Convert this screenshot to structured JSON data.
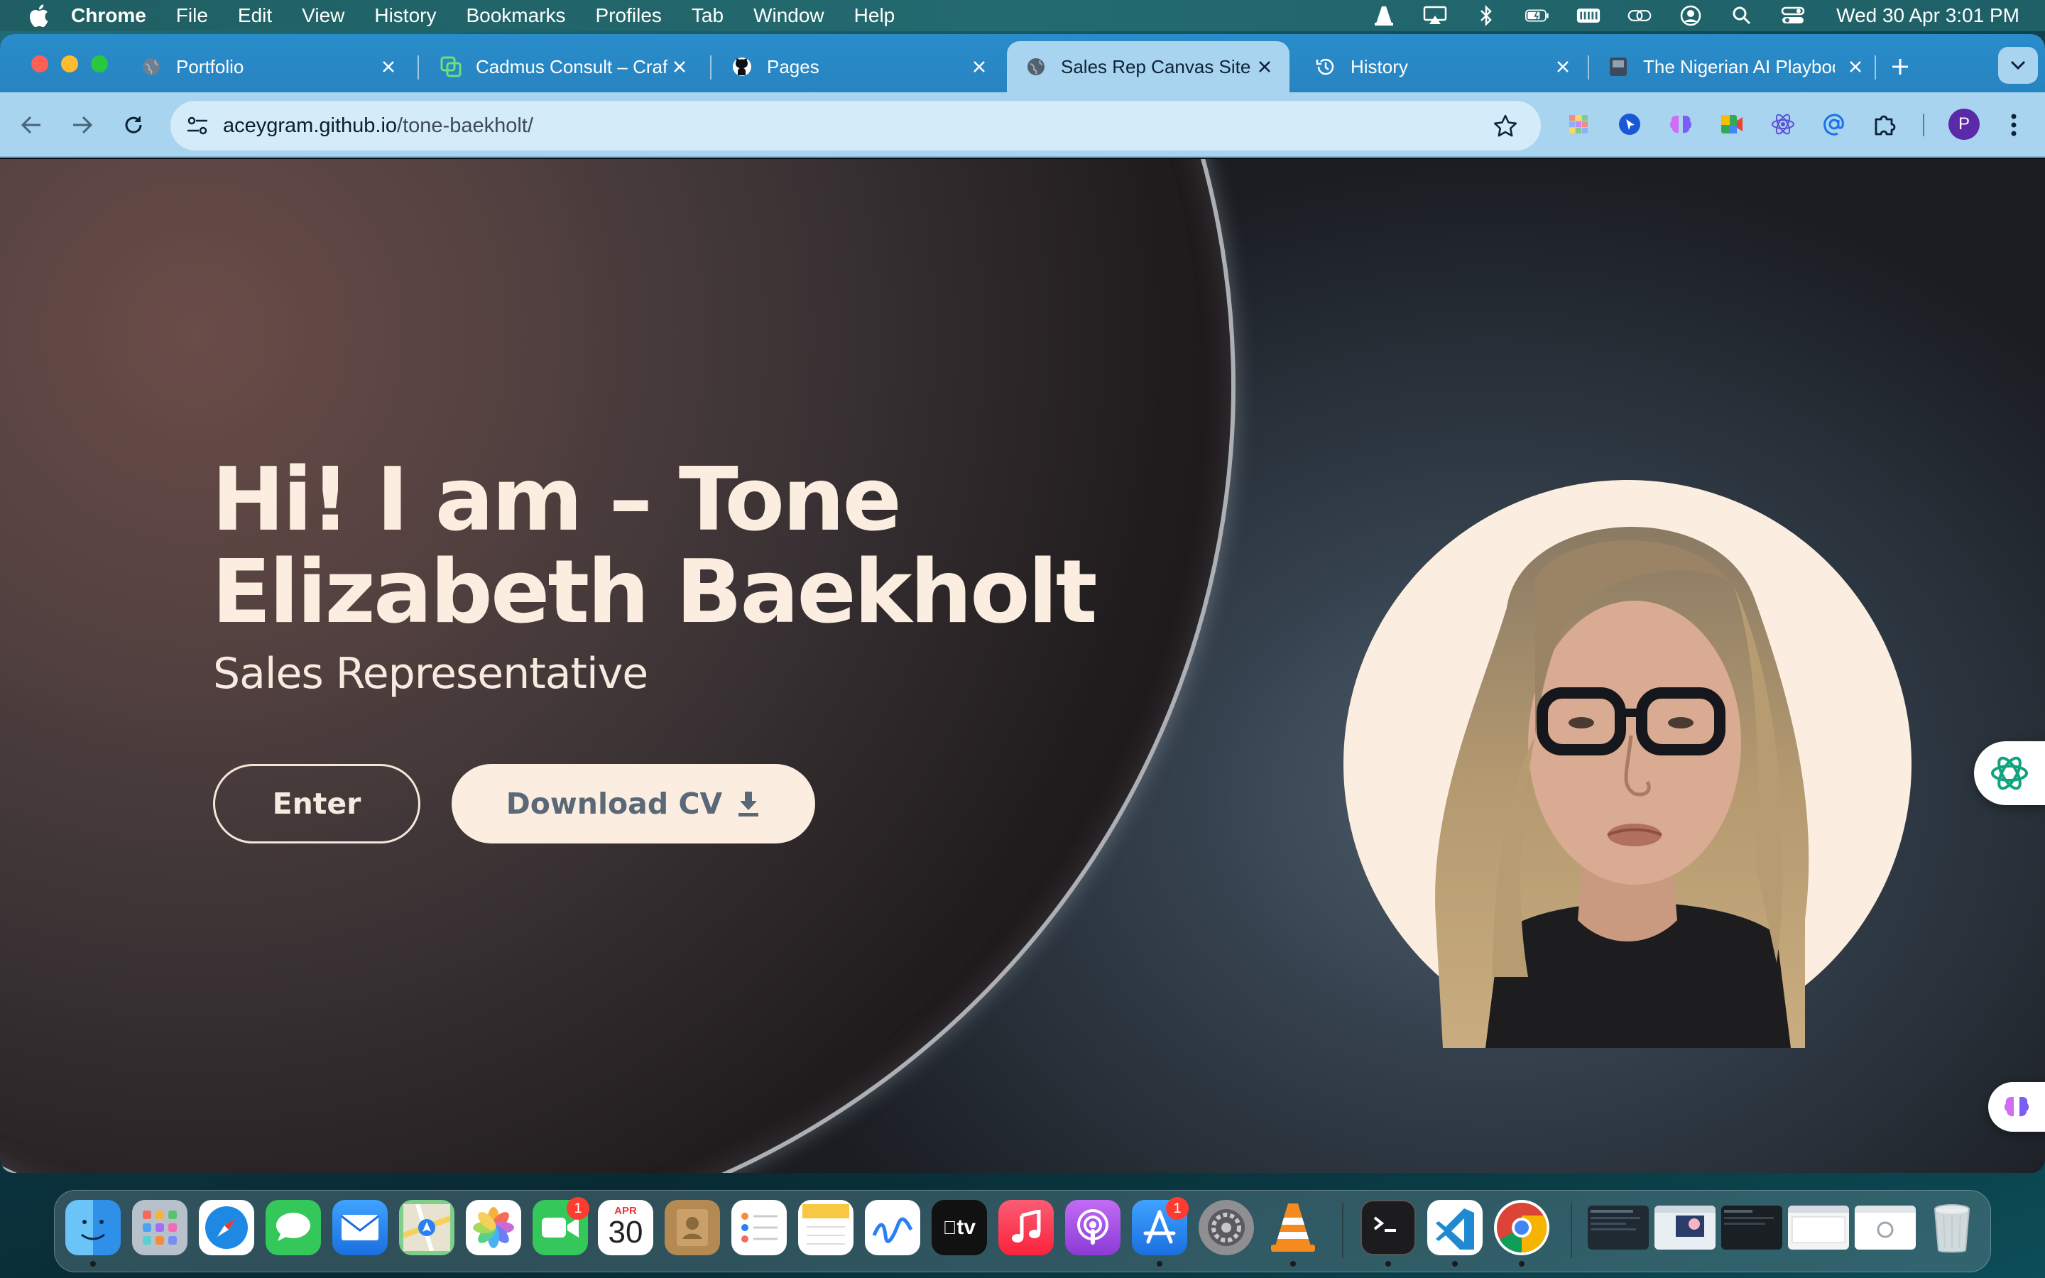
{
  "menubar": {
    "app_name": "Chrome",
    "items": [
      "File",
      "Edit",
      "View",
      "History",
      "Bookmarks",
      "Profiles",
      "Tab",
      "Window",
      "Help"
    ],
    "status_icons": [
      "vlc-icon",
      "airplay-icon",
      "bluetooth-icon",
      "battery-icon",
      "keyboard-icon",
      "link-icon",
      "user-icon",
      "search-icon",
      "control-center-icon"
    ],
    "clock": "Wed 30 Apr  3:01 PM"
  },
  "browser": {
    "tabs": [
      {
        "title": "Portfolio",
        "icon": "globe-icon"
      },
      {
        "title": "Cadmus Consult – Craft",
        "icon": "cadmus-icon"
      },
      {
        "title": "Pages",
        "icon": "github-icon"
      },
      {
        "title": "Sales Rep Canvas Site",
        "icon": "globe-icon",
        "active": true
      },
      {
        "title": "History",
        "icon": "history-icon"
      },
      {
        "title": "The Nigerian AI Playbook",
        "icon": "book-icon"
      }
    ],
    "url_host": "aceygram.github.io",
    "url_path": "/tone-baekholt/",
    "profile_initial": "P",
    "extensions": [
      "grid-extension-icon",
      "cursor-extension-icon",
      "brain-extension-icon",
      "meet-extension-icon",
      "react-extension-icon",
      "at-extension-icon",
      "puzzle-icon"
    ]
  },
  "hero": {
    "title_line1": "Hi! I am – Tone",
    "title_line2": "Elizabeth Baekholt",
    "subtitle": "Sales Representative",
    "enter_label": "Enter",
    "download_label": "Download CV"
  },
  "dock": {
    "apps": [
      "Finder",
      "Launchpad",
      "Safari",
      "Messages",
      "Mail",
      "Maps",
      "Photos",
      "FaceTime",
      "Calendar",
      "Contacts",
      "Reminders",
      "Notes",
      "Freeform",
      "TV",
      "Music",
      "Podcasts",
      "App Store",
      "System Settings",
      "VLC",
      "Terminal",
      "VS Code",
      "Chrome"
    ],
    "facetime_badge": "1",
    "appstore_badge": "1",
    "calendar_month": "APR",
    "calendar_day": "30",
    "tv_label": "tv"
  },
  "colors": {
    "accent_cream": "#fbeee0",
    "tab_bar": "#2a8ccb",
    "toolbar": "#a8d4f0",
    "button_text": "#5b6878"
  }
}
